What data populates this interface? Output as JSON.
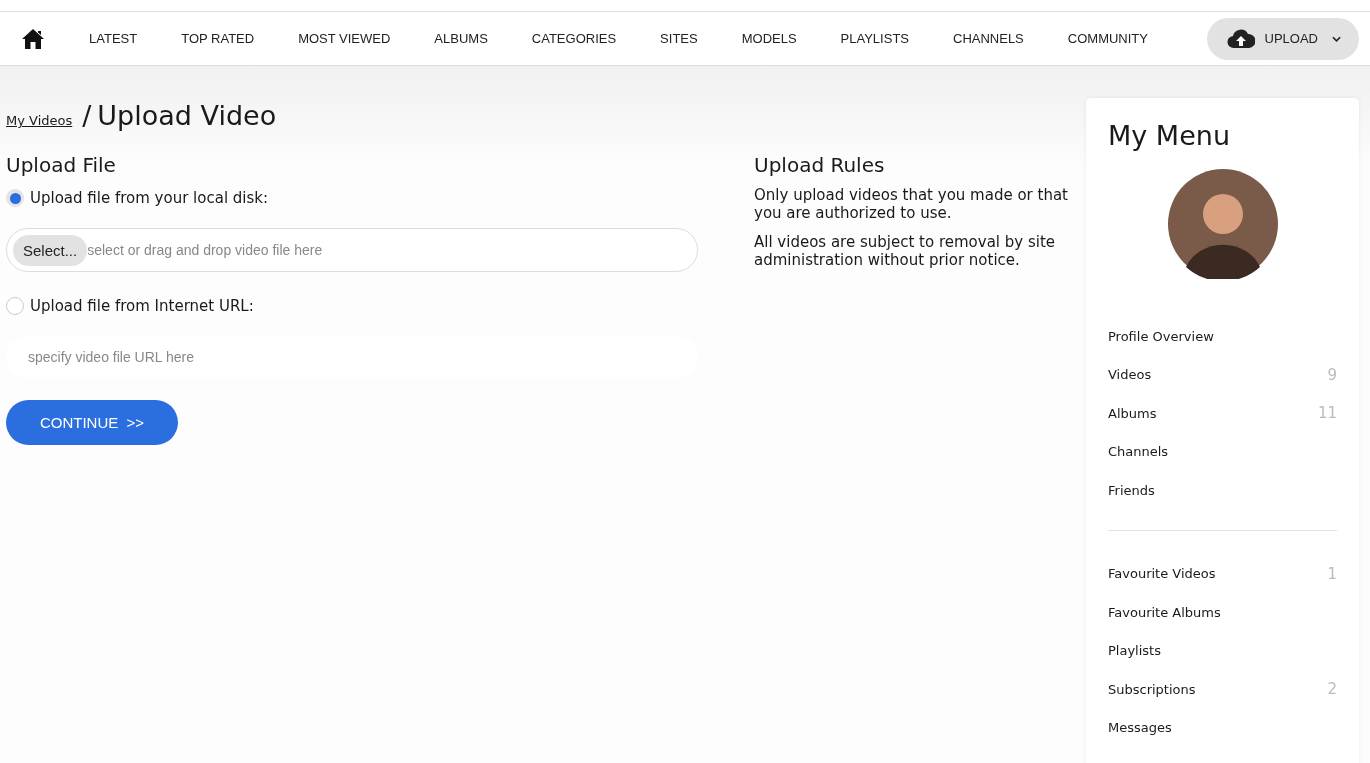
{
  "nav": {
    "items": [
      "LATEST",
      "TOP RATED",
      "MOST VIEWED",
      "ALBUMS",
      "CATEGORIES",
      "SITES",
      "MODELS",
      "PLAYLISTS",
      "CHANNELS",
      "COMMUNITY"
    ],
    "upload": "UPLOAD"
  },
  "breadcrumb": {
    "link": "My Videos",
    "separator": "/",
    "title": "Upload Video"
  },
  "upload_file": {
    "heading": "Upload File",
    "sources": [
      {
        "kind": "file",
        "label": "Upload file from your local disk:",
        "selected": true,
        "button": "Select...",
        "placeholder": "select or drag and drop video file here"
      },
      {
        "kind": "url",
        "label": "Upload file from Internet URL:",
        "selected": false,
        "placeholder": "specify video file URL here"
      }
    ],
    "continue": "CONTINUE  >>"
  },
  "rules": {
    "heading": "Upload Rules",
    "paragraphs": [
      "Only upload videos that you made or that you are authorized to use.",
      "All videos are subject to removal by site administration without prior notice."
    ]
  },
  "menu": {
    "title": "My Menu",
    "groups": [
      [
        {
          "label": "Profile Overview"
        },
        {
          "label": "Videos",
          "count": "9"
        },
        {
          "label": "Albums",
          "count": "11"
        },
        {
          "label": "Channels"
        },
        {
          "label": "Friends"
        }
      ],
      [
        {
          "label": "Favourite Videos",
          "count": "1"
        },
        {
          "label": "Favourite Albums"
        },
        {
          "label": "Playlists"
        },
        {
          "label": "Subscriptions",
          "count": "2"
        },
        {
          "label": "Messages"
        }
      ]
    ]
  }
}
